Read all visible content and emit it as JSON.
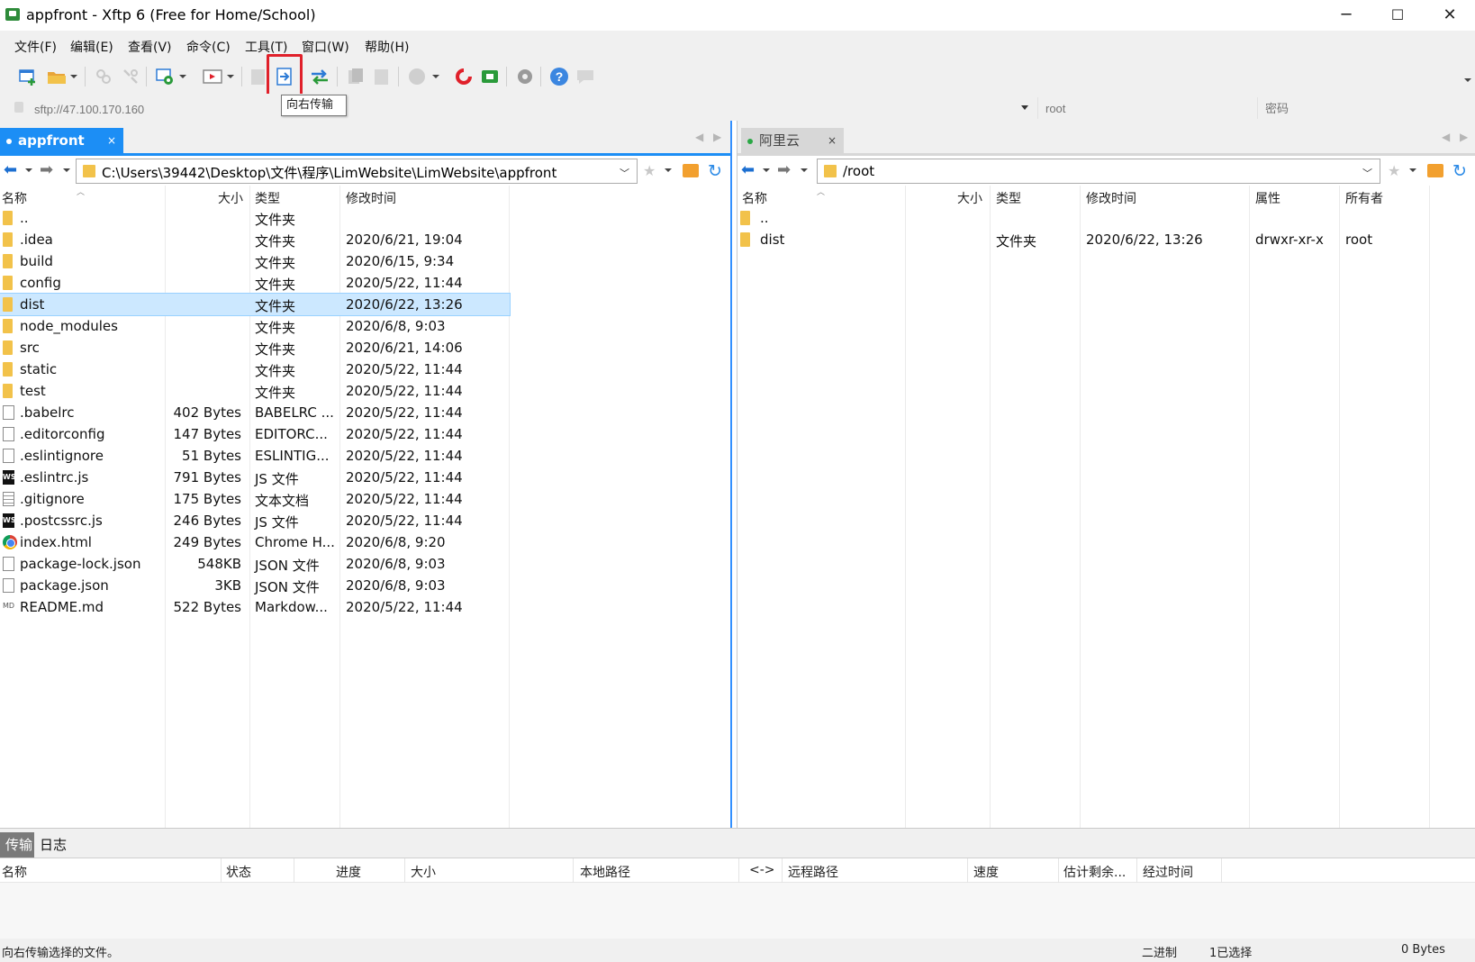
{
  "window": {
    "title": "appfront - Xftp 6 (Free for Home/School)",
    "minimize": "─",
    "maximize": "☐",
    "close": "✕"
  },
  "menu": [
    "文件(F)",
    "编辑(E)",
    "查看(V)",
    "命令(C)",
    "工具(T)",
    "窗口(W)",
    "帮助(H)"
  ],
  "toolbar": {
    "tooltip": "向右传输",
    "highlighted_button": "transfer-right"
  },
  "address": {
    "host_placeholder": "sftp://47.100.170.160",
    "user_placeholder": "root",
    "password_placeholder": "密码"
  },
  "left_panel": {
    "tab_label": "appfront",
    "tab_close": "×",
    "path": "C:\\Users\\39442\\Desktop\\文件\\程序\\LimWebsite\\LimWebsite\\appfront",
    "columns": [
      "名称",
      "大小",
      "类型",
      "修改时间"
    ],
    "rows": [
      {
        "icon": "folder",
        "name": "..",
        "size": "",
        "type": "文件夹",
        "modified": ""
      },
      {
        "icon": "folder",
        "name": ".idea",
        "size": "",
        "type": "文件夹",
        "modified": "2020/6/21, 19:04"
      },
      {
        "icon": "folder",
        "name": "build",
        "size": "",
        "type": "文件夹",
        "modified": "2020/6/15, 9:34"
      },
      {
        "icon": "folder",
        "name": "config",
        "size": "",
        "type": "文件夹",
        "modified": "2020/5/22, 11:44"
      },
      {
        "icon": "folder",
        "name": "dist",
        "size": "",
        "type": "文件夹",
        "modified": "2020/6/22, 13:26",
        "selected": true
      },
      {
        "icon": "folder",
        "name": "node_modules",
        "size": "",
        "type": "文件夹",
        "modified": "2020/6/8, 9:03"
      },
      {
        "icon": "folder",
        "name": "src",
        "size": "",
        "type": "文件夹",
        "modified": "2020/6/21, 14:06"
      },
      {
        "icon": "folder",
        "name": "static",
        "size": "",
        "type": "文件夹",
        "modified": "2020/5/22, 11:44"
      },
      {
        "icon": "folder",
        "name": "test",
        "size": "",
        "type": "文件夹",
        "modified": "2020/5/22, 11:44"
      },
      {
        "icon": "file",
        "name": ".babelrc",
        "size": "402 Bytes",
        "type": "BABELRC ...",
        "modified": "2020/5/22, 11:44"
      },
      {
        "icon": "file",
        "name": ".editorconfig",
        "size": "147 Bytes",
        "type": "EDITORC...",
        "modified": "2020/5/22, 11:44"
      },
      {
        "icon": "file",
        "name": ".eslintignore",
        "size": "51 Bytes",
        "type": "ESLINTIG...",
        "modified": "2020/5/22, 11:44"
      },
      {
        "icon": "ws",
        "name": ".eslintrc.js",
        "size": "791 Bytes",
        "type": "JS 文件",
        "modified": "2020/5/22, 11:44"
      },
      {
        "icon": "txt",
        "name": ".gitignore",
        "size": "175 Bytes",
        "type": "文本文档",
        "modified": "2020/5/22, 11:44"
      },
      {
        "icon": "ws",
        "name": ".postcssrc.js",
        "size": "246 Bytes",
        "type": "JS 文件",
        "modified": "2020/5/22, 11:44"
      },
      {
        "icon": "chrome",
        "name": "index.html",
        "size": "249 Bytes",
        "type": "Chrome H...",
        "modified": "2020/6/8, 9:20"
      },
      {
        "icon": "file",
        "name": "package-lock.json",
        "size": "548KB",
        "type": "JSON 文件",
        "modified": "2020/6/8, 9:03"
      },
      {
        "icon": "file",
        "name": "package.json",
        "size": "3KB",
        "type": "JSON 文件",
        "modified": "2020/6/8, 9:03"
      },
      {
        "icon": "md",
        "name": "README.md",
        "size": "522 Bytes",
        "type": "Markdow...",
        "modified": "2020/5/22, 11:44"
      }
    ]
  },
  "right_panel": {
    "tab_label": "阿里云",
    "tab_close": "×",
    "path": "/root",
    "columns": [
      "名称",
      "大小",
      "类型",
      "修改时间",
      "属性",
      "所有者"
    ],
    "rows": [
      {
        "icon": "folder",
        "name": "..",
        "size": "",
        "type": "",
        "modified": "",
        "attr": "",
        "owner": ""
      },
      {
        "icon": "folder",
        "name": "dist",
        "size": "",
        "type": "文件夹",
        "modified": "2020/6/22, 13:26",
        "attr": "drwxr-xr-x",
        "owner": "root"
      }
    ]
  },
  "transfer": {
    "tabs": [
      "传输",
      "日志"
    ],
    "columns": [
      "名称",
      "状态",
      "进度",
      "大小",
      "本地路径",
      "<->",
      "远程路径",
      "速度",
      "估计剩余...",
      "经过时间"
    ]
  },
  "status_bar": {
    "message": "向右传输选择的文件。",
    "mode": "二进制",
    "selection": "1已选择",
    "size": "0 Bytes"
  },
  "colors": {
    "accent": "#1c8ef5",
    "selection": "#cce8ff",
    "highlight_box": "#e0202a",
    "folder": "#f2c24a"
  }
}
